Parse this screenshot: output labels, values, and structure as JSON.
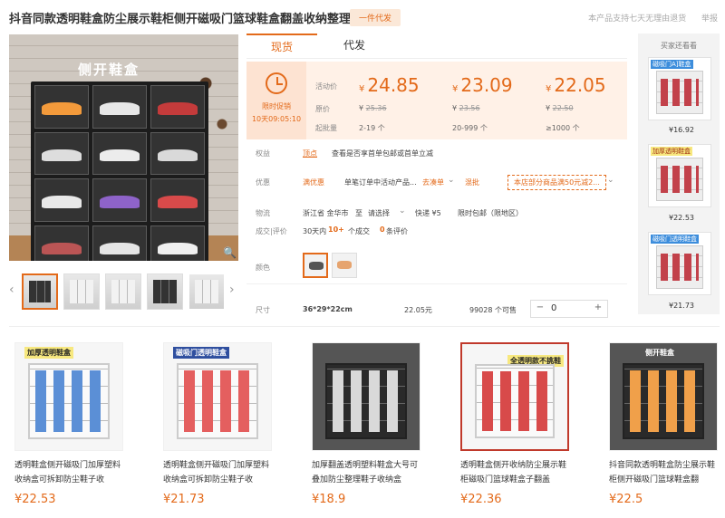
{
  "header": {
    "title": "抖音同款透明鞋盒防尘展示鞋柜侧开磁吸门篮球鞋盒翻盖收纳整理盒",
    "badge": "一件代发",
    "tip1": "本产品支持七天无理由退货",
    "tip2": "举报"
  },
  "gallery": {
    "caption": "侧开鞋盒",
    "prev": "‹",
    "next": "›",
    "zoom": "🔍"
  },
  "tabs": [
    "现货",
    "代发"
  ],
  "price": {
    "timer_label": "限时促销",
    "timer_value": "10天09:05:10",
    "row_labels": [
      "活动价",
      "原价",
      "起批量"
    ],
    "currency": "¥",
    "tiers": [
      {
        "price": "24.85",
        "original": "25.36",
        "min": "2-19 个"
      },
      {
        "price": "23.09",
        "original": "23.56",
        "min": "20-999 个"
      },
      {
        "price": "22.05",
        "original": "22.50",
        "min": "≥1000 个"
      }
    ]
  },
  "rights": {
    "label": "权益",
    "tag": "顶点",
    "text": "查看是否享首单包邮或首单立减"
  },
  "promo": {
    "label": "优惠",
    "type": "满优惠",
    "text": "单笔订单中活动产品...",
    "coupon": "去凑单",
    "more": "混批",
    "benefit": "本店部分商品满50元减2...",
    "chevron": "⌄"
  },
  "logistics": {
    "label": "物流",
    "from": "浙江省 金华市",
    "to_label": "至",
    "to": "请选择",
    "fee": "快递 ¥5",
    "free": "限时包邮（限地区）"
  },
  "deals": {
    "label": "成交|评价",
    "period": "30天内",
    "count": "10+",
    "unit": "个成交",
    "reviews": "0",
    "reviews_unit": "条评价"
  },
  "color": {
    "label": "颜色"
  },
  "sku": {
    "label": "尺寸",
    "size": "36*29*22cm",
    "price": "22.05元",
    "stock": "99028 个可售",
    "minus": "−",
    "qty": "0",
    "plus": "+"
  },
  "side": {
    "heading": "买家还看看",
    "items": [
      {
        "label": "磁吸门A]鞋盒",
        "price": "¥16.92"
      },
      {
        "label": "加厚透明鞋盒",
        "price": "¥22.53"
      },
      {
        "label": "磁吸门透明鞋盒",
        "price": "¥21.73"
      }
    ]
  },
  "products": [
    {
      "tag": "加厚透明鞋盒",
      "title": "透明鞋盒侧开磁吸门加厚塑料收纳盒可拆卸防尘鞋子收",
      "price": "¥22.53"
    },
    {
      "tag": "磁吸门透明鞋盒",
      "title": "透明鞋盒侧开磁吸门加厚塑料收纳盒可拆卸防尘鞋子收",
      "price": "¥21.73"
    },
    {
      "tag": "",
      "title": "加厚翻盖透明塑料鞋盒大号可叠加防尘整理鞋子收纳盒",
      "price": "¥18.9"
    },
    {
      "tag": "全透明款不挑鞋",
      "title": "透明鞋盒侧开收纳防尘展示鞋柜磁吸门篮球鞋盒子翻盖",
      "price": "¥22.36"
    },
    {
      "tag": "侧开鞋盒",
      "title": "抖音同款透明鞋盒防尘展示鞋柜侧开磁吸门篮球鞋盒翻",
      "price": "¥22.5"
    }
  ]
}
